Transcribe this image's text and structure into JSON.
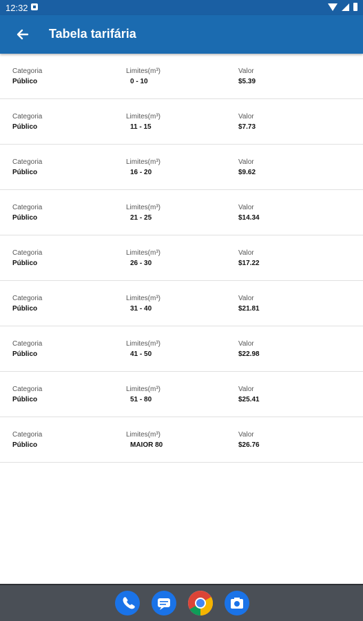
{
  "status_bar": {
    "time": "12:32"
  },
  "app_bar": {
    "title": "Tabela tarifária"
  },
  "columns": {
    "categoria": "Categoria",
    "limites": "Limites(m³)",
    "valor": "Valor"
  },
  "rows": [
    {
      "categoria": "Público",
      "limites": "0 - 10",
      "valor": "$5.39"
    },
    {
      "categoria": "Público",
      "limites": "11 - 15",
      "valor": "$7.73"
    },
    {
      "categoria": "Público",
      "limites": "16 - 20",
      "valor": "$9.62"
    },
    {
      "categoria": "Público",
      "limites": "21 - 25",
      "valor": "$14.34"
    },
    {
      "categoria": "Público",
      "limites": "26 - 30",
      "valor": "$17.22"
    },
    {
      "categoria": "Público",
      "limites": "31 - 40",
      "valor": "$21.81"
    },
    {
      "categoria": "Público",
      "limites": "41 - 50",
      "valor": "$22.98"
    },
    {
      "categoria": "Público",
      "limites": "51 - 80",
      "valor": "$25.41"
    },
    {
      "categoria": "Público",
      "limites": "MAIOR 80",
      "valor": "$26.76"
    }
  ],
  "dock": [
    "phone-icon",
    "messages-icon",
    "chrome-icon",
    "camera-icon"
  ]
}
